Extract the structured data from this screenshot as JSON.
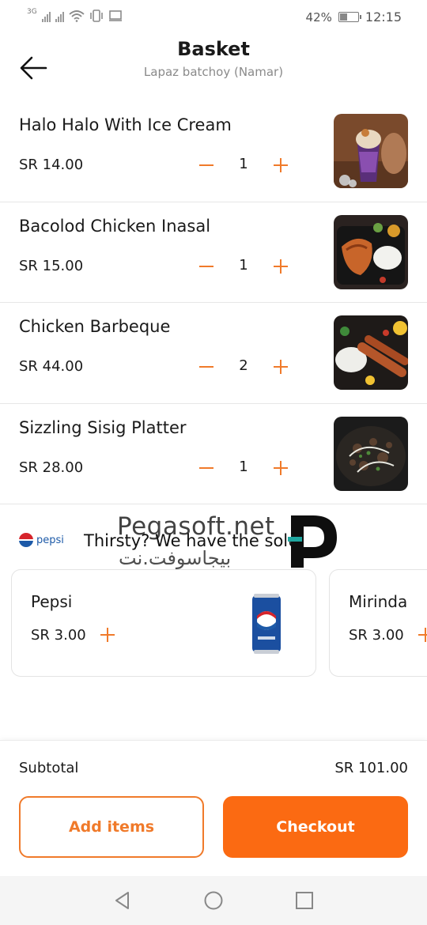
{
  "status_bar": {
    "network_label": "3G",
    "battery_percent_text": "42%",
    "battery_level": 0.42,
    "time": "12:15",
    "icons": [
      "signal-bars-icon",
      "wifi-icon",
      "vibrate-icon",
      "cast-icon",
      "battery-icon"
    ]
  },
  "header": {
    "title": "Basket",
    "subtitle": "Lapaz batchoy (Namar)",
    "back_icon": "arrow-left-icon"
  },
  "items": [
    {
      "name": "Halo Halo With Ice Cream",
      "price": "SR 14.00",
      "quantity": "1",
      "image": "halo-halo-photo"
    },
    {
      "name": "Bacolod Chicken Inasal",
      "price": "SR 15.00",
      "quantity": "1",
      "image": "chicken-inasal-photo"
    },
    {
      "name": "Chicken Barbeque",
      "price": "SR 44.00",
      "quantity": "2",
      "image": "chicken-barbeque-photo"
    },
    {
      "name": "Sizzling Sisig Platter",
      "price": "SR 28.00",
      "quantity": "1",
      "image": "sisig-platter-photo"
    }
  ],
  "promo": {
    "brand": "pepsi",
    "text": "Thirsty? We have the solution!",
    "watermark": "Pegasoft.net",
    "watermark_arabic": "بيجاسوفت.نت"
  },
  "drinks": [
    {
      "name": "Pepsi",
      "price": "SR 3.00",
      "image": "pepsi-can"
    },
    {
      "name": "Mirinda",
      "price": "SR 3.00",
      "image": "mirinda-can"
    }
  ],
  "footer": {
    "subtotal_label": "Subtotal",
    "subtotal_value": "SR 101.00",
    "add_items_label": "Add items",
    "checkout_label": "Checkout"
  },
  "colors": {
    "accent": "#f07a2a",
    "checkout_bg": "#fb6a12",
    "text": "#1a1a1a",
    "muted": "#8a8a8a"
  },
  "nav": [
    "back-triangle-icon",
    "home-circle-icon",
    "recents-square-icon"
  ]
}
